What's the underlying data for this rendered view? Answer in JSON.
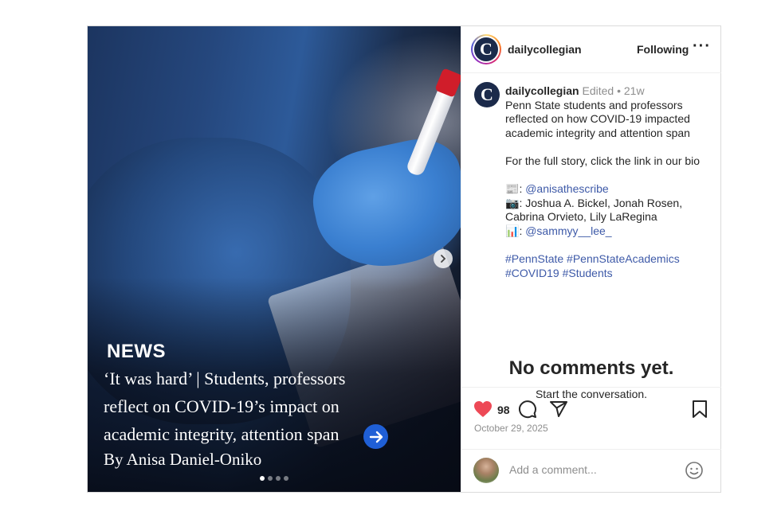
{
  "media": {
    "section": "NEWS",
    "headline": "‘It was hard’ | Students, professors reflect on COVID-19’s impact on academic integrity, attention span",
    "byline": "By Anisa Daniel-Oniko",
    "slide_count": 4,
    "active_slide": 1
  },
  "header": {
    "username": "dailycollegian",
    "follow_label": "Following",
    "more_label": "···",
    "logo_letter": "C"
  },
  "caption": {
    "username": "dailycollegian",
    "edited": "Edited",
    "separator": "•",
    "age": "21w",
    "line1": "Penn State students and professors reflected on how COVID-19 impacted academic integrity and attention span",
    "line2": "For the full story, click the link in our bio",
    "credit_writer_icon": "📰",
    "credit_writer_prefix": ": ",
    "credit_writer": "@anisathescribe",
    "credit_photo_icon": "📷",
    "credit_photo": ": Joshua A. Bickel, Jonah Rosen, Cabrina Orvieto, Lily LaRegina",
    "credit_graphic_icon": "📊",
    "credit_graphic_prefix": ": ",
    "credit_graphic": "@sammyy__lee_",
    "hashtags_line1": "#PennState #PennStateAcademics",
    "hashtags_line2": "#COVID19 #Students"
  },
  "empty_state": {
    "title": "No comments yet.",
    "subtitle": "Start the conversation."
  },
  "actions": {
    "like_count": "98",
    "date": "October 29, 2025"
  },
  "comment": {
    "placeholder": "Add a comment..."
  },
  "colors": {
    "like": "#ed4956",
    "link": "#3e5aa8",
    "arrow_button": "#1f5fd6"
  }
}
